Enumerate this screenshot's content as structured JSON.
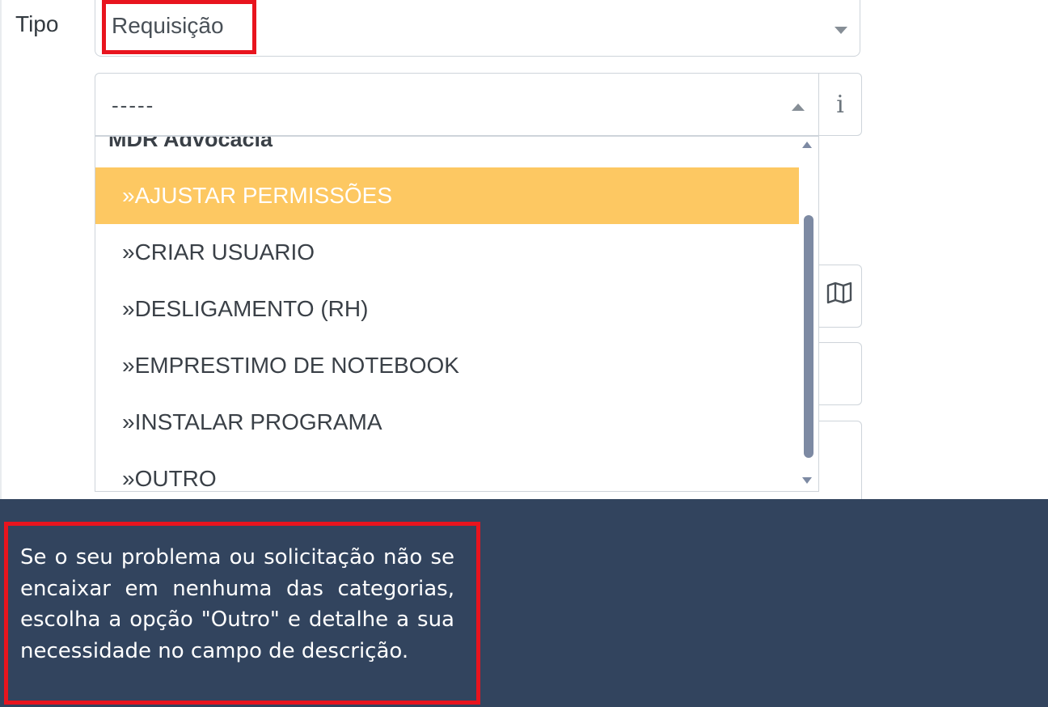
{
  "form": {
    "tipo_label": "Tipo",
    "tipo_value": "Requisição",
    "category_value": "-----",
    "info_icon_glyph": "i"
  },
  "dropdown": {
    "group_header": "MDR Advocacia",
    "options": [
      {
        "label": "»AJUSTAR PERMISSÕES",
        "active": true
      },
      {
        "label": "»CRIAR USUARIO",
        "active": false
      },
      {
        "label": "»DESLIGAMENTO (RH)",
        "active": false
      },
      {
        "label": "»EMPRESTIMO DE NOTEBOOK",
        "active": false
      },
      {
        "label": "»INSTALAR PROGRAMA",
        "active": false
      },
      {
        "label": "»OUTRO",
        "active": false
      }
    ]
  },
  "tooltip": {
    "text": "Se o seu problema ou solicitação não se encaixar em nenhuma das categorias, escolha a opção \"Outro\" e detalhe a sua necessidade no campo de descrição."
  },
  "colors": {
    "highlight": "#e8141e",
    "active_option": "#fdc862",
    "tooltip_bg": "#32445e"
  },
  "icons": {
    "info": "info-icon",
    "map": "map-icon",
    "select_caret": "chevron-down-icon"
  }
}
